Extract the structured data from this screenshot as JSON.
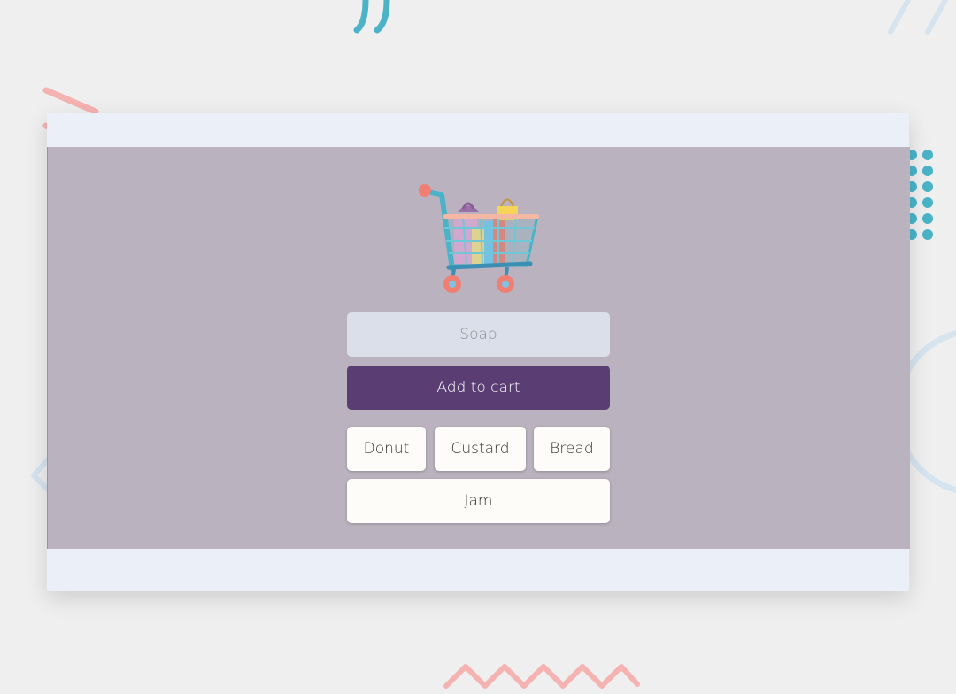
{
  "input": {
    "placeholder": "Soap",
    "value": ""
  },
  "add_button": {
    "label": "Add to cart"
  },
  "items": [
    {
      "label": "Donut"
    },
    {
      "label": "Custard"
    },
    {
      "label": "Bread"
    },
    {
      "label": "Jam"
    }
  ],
  "colors": {
    "background": "#efefef",
    "card": "#ebf0f8",
    "panel": "#bab2be",
    "input_bg": "#dbdfea",
    "accent": "#5a3d73",
    "chip_bg": "#fdfcf8",
    "deco_teal": "#4ab3c8",
    "deco_pink": "#f4b2b0",
    "deco_blue": "#d6e4f0"
  },
  "icons": {
    "logo": "shopping-cart-icon"
  }
}
